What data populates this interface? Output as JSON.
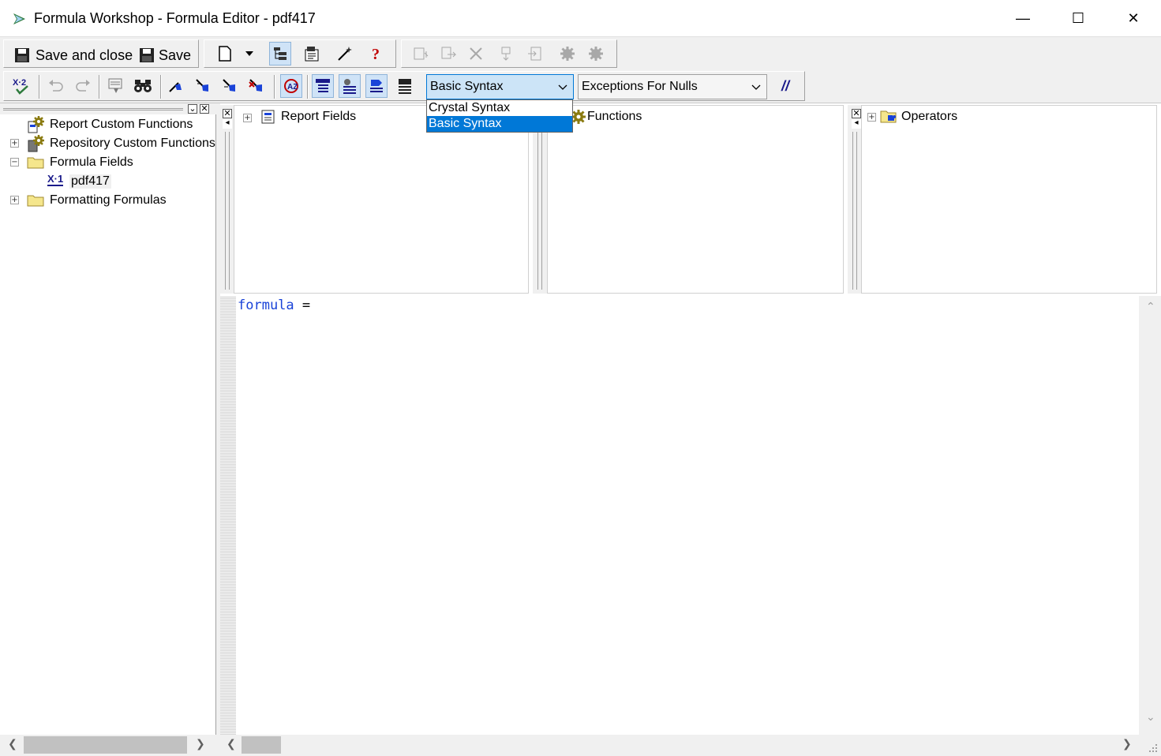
{
  "window": {
    "title": "Formula Workshop - Formula Editor - pdf417",
    "minimize": "—",
    "maximize": "☐",
    "close": "✕"
  },
  "toolbar1": {
    "save_close_label": "Save and close",
    "save_label": "Save"
  },
  "toolbar2": {
    "syntax_combo_value": "Basic Syntax",
    "nulls_combo_value": "Exceptions For Nulls",
    "comment_label": "//"
  },
  "syntax_dropdown": {
    "options": [
      "Crystal Syntax",
      "Basic Syntax"
    ],
    "selected": "Basic Syntax"
  },
  "tree": {
    "items": [
      {
        "label": "Report Custom Functions",
        "icon": "gear-report-icon",
        "expander": ""
      },
      {
        "label": "Repository Custom Functions",
        "icon": "gear-repository-icon",
        "expander": "+"
      },
      {
        "label": "Formula Fields",
        "icon": "folder-icon",
        "expander": "−"
      },
      {
        "label": "pdf417",
        "icon": "formula-icon",
        "expander": ""
      },
      {
        "label": "Formatting Formulas",
        "icon": "folder-icon",
        "expander": "+"
      }
    ],
    "formula_icon_text": "X·1",
    "pin_button": "⌄",
    "close_button": "✕"
  },
  "browsers": {
    "fields_label": "Report Fields",
    "functions_label": "Functions",
    "operators_label": "Operators",
    "close_glyph": "✕",
    "left_glyph": "◂",
    "expander": "+"
  },
  "editor": {
    "keyword": "formula",
    "rest": " ="
  },
  "scroll": {
    "left": "❮",
    "right": "❯",
    "up": "⌃",
    "down": "⌄"
  },
  "colors": {
    "selection": "#0078d7",
    "keyword": "#1a43d8",
    "toolbar_bg": "#f0f0f0"
  }
}
